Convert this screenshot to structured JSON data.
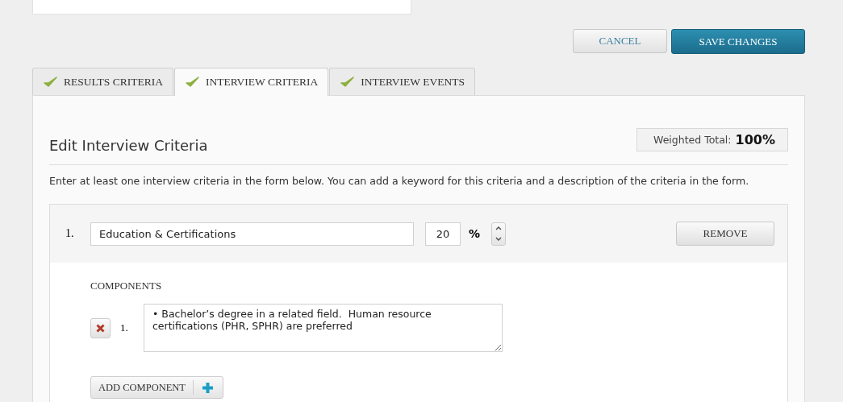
{
  "actions": {
    "cancel": "CANCEL",
    "save": "SAVE CHANGES"
  },
  "tabs": [
    {
      "label": "RESULTS CRITERIA",
      "selected": false,
      "completed": true
    },
    {
      "label": "INTERVIEW CRITERIA",
      "selected": true,
      "completed": true
    },
    {
      "label": "INTERVIEW EVENTS",
      "selected": false,
      "completed": true
    }
  ],
  "panel": {
    "title": "Edit Interview Criteria",
    "weighted_total_label": "Weighted Total:",
    "weighted_total_value": "100%",
    "description": "Enter at least one interview criteria in the form below. You can add a keyword for this criteria and a description of the criteria in the form.",
    "criteria": [
      {
        "number": "1.",
        "name": "Education & Certifications",
        "percent": "20",
        "percent_sign": "%",
        "remove": "REMOVE",
        "components_label": "COMPONENTS",
        "components": [
          {
            "number": "1.",
            "text": "• Bachelor’s degree in a related field.  Human resource certifications (PHR, SPHR) are preferred"
          }
        ],
        "add_component": "ADD COMPONENT"
      }
    ]
  }
}
